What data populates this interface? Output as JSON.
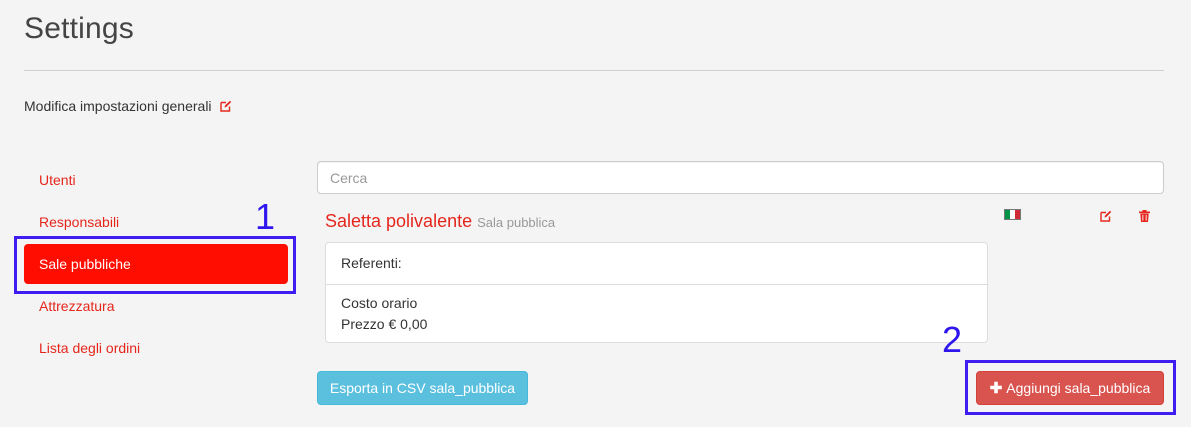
{
  "header": {
    "title": "Settings",
    "general_settings_label": "Modifica impostazioni generali"
  },
  "sidebar": {
    "items": [
      {
        "label": "Utenti",
        "active": false
      },
      {
        "label": "Responsabili",
        "active": false
      },
      {
        "label": "Sale pubbliche",
        "active": true
      },
      {
        "label": "Attrezzatura",
        "active": false
      },
      {
        "label": "Lista degli ordini",
        "active": false
      }
    ]
  },
  "search": {
    "placeholder": "Cerca",
    "value": ""
  },
  "item": {
    "name": "Saletta polivalente",
    "type": "Sala pubblica",
    "referents_label": "Referenti:",
    "cost_label": "Costo orario",
    "price_text": "Prezzo € 0,00",
    "language_flag": "italian-flag-icon"
  },
  "actions": {
    "export_csv_label": "Esporta in CSV sala_pubblica",
    "add_label": "Aggiungi sala_pubblica"
  },
  "annotations": {
    "marker_1": "1",
    "marker_2": "2"
  },
  "colors": {
    "accent_red": "#e5261c",
    "active_bg": "#ff0d00",
    "info_blue": "#5bc0de",
    "danger": "#d9534f",
    "annotation": "#3d1df2"
  }
}
